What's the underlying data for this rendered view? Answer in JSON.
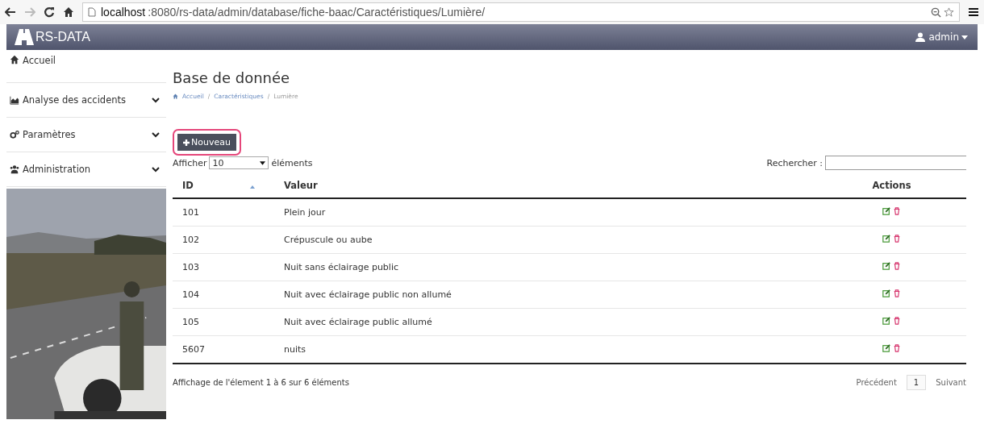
{
  "browser": {
    "url_host": "localhost",
    "url_path": ":8080/rs-data/admin/database/fiche-baac/Caractéristiques/Lumière/"
  },
  "navbar": {
    "brand": "RS-DATA",
    "user": "admin"
  },
  "sidebar": {
    "items": [
      {
        "label": "Accueil",
        "expandable": false
      },
      {
        "label": "Analyse des accidents",
        "expandable": true
      },
      {
        "label": "Paramètres",
        "expandable": true
      },
      {
        "label": "Administration",
        "expandable": true
      }
    ]
  },
  "page": {
    "title": "Base de donnée",
    "breadcrumb": [
      {
        "label": "Accueil",
        "separator": "/"
      },
      {
        "label": "Caractéristiques",
        "separator": "/"
      },
      {
        "label": "Lumière"
      }
    ],
    "new_button": "Nouveau",
    "new_button_highlighted": true
  },
  "table_controls": {
    "show_label": "Afficher",
    "page_size": "10",
    "entries_label": "éléments",
    "search_label": "Rechercher :"
  },
  "table": {
    "columns": [
      "ID",
      "Valeur",
      "Actions"
    ],
    "rows": [
      {
        "id": "101",
        "value": "Plein jour"
      },
      {
        "id": "102",
        "value": "Crépuscule ou aube"
      },
      {
        "id": "103",
        "value": "Nuit sans éclairage public"
      },
      {
        "id": "104",
        "value": "Nuit avec éclairage public non allumé"
      },
      {
        "id": "105",
        "value": "Nuit avec éclairage public allumé"
      },
      {
        "id": "5607",
        "value": "nuits"
      }
    ]
  },
  "footer": {
    "info": "Affichage de l'élement 1 à 6 sur 6 éléments",
    "prev": "Précédent",
    "page": "1",
    "next": "Suivant"
  }
}
